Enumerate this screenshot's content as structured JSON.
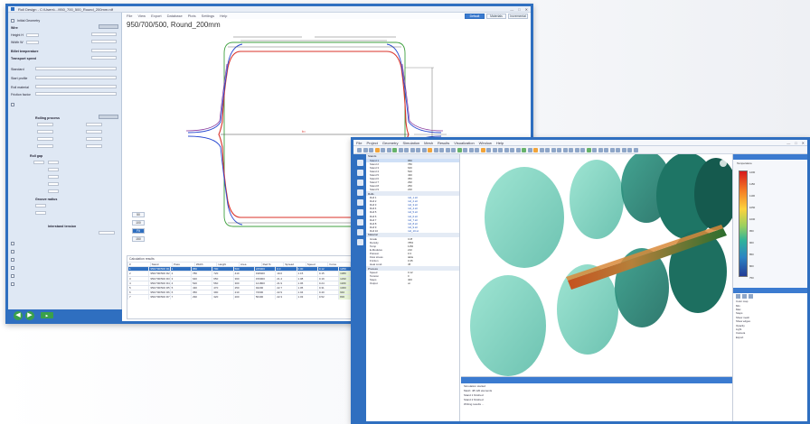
{
  "window1": {
    "title": "Roll Design - C:\\Users\\...\\950_700_500_Round_200mm.rdf",
    "menu": [
      "File",
      "View",
      "Export",
      "Database",
      "Plots",
      "Settings",
      "Help"
    ],
    "tabs": [
      "Default",
      "Materials",
      "Incremental"
    ],
    "drawing_title": "950/700/500, Round_200mm",
    "sidebar": [
      "Initial Geometry",
      "Wire",
      "Height H",
      "Width W",
      "Billet temperature",
      "Transport speed",
      "Standard",
      "Start profile",
      "Roll material",
      "Friction factor",
      "Rolling process",
      "Roll gap",
      "Groove radius",
      "Interstand tension",
      "Stand layout",
      "Pass schedule"
    ],
    "zoom_buttons": [
      "50",
      "100",
      "Fit",
      "150"
    ],
    "table_caption": "Calculation results",
    "table_headers": [
      "#",
      "Stand",
      "Pass",
      "Width",
      "Height",
      "Area",
      "Red %",
      "Spread",
      "Speed",
      "Force",
      "Torque",
      "Power",
      "Temp",
      "Gap",
      "Radius",
      "Strain",
      "Rate",
      "Dia"
    ],
    "table_rows": [
      [
        "950/700/500 R1",
        "1",
        "950",
        "700",
        "500",
        "245000",
        "0.0",
        "0.00",
        "0.12",
        "1250",
        "145",
        "210",
        "1150",
        "25",
        "200",
        "0.21",
        "0.45",
        "950"
      ],
      [
        "950/700/500 R2",
        "2",
        "780",
        "720",
        "410",
        "198400",
        "19.0",
        "1.15",
        "0.15",
        "1380",
        "162",
        "245",
        "1135",
        "22",
        "200",
        "0.24",
        "0.52",
        "950"
      ],
      [
        "950/700/500 R3",
        "3",
        "640",
        "650",
        "360",
        "156000",
        "21.4",
        "1.08",
        "0.19",
        "1290",
        "151",
        "238",
        "1120",
        "20",
        "180",
        "0.26",
        "0.61",
        "900"
      ],
      [
        "950/700/500 R4",
        "4",
        "520",
        "560",
        "300",
        "121800",
        "21.9",
        "1.06",
        "0.24",
        "1180",
        "138",
        "226",
        "1105",
        "18",
        "160",
        "0.27",
        "0.73",
        "850"
      ],
      [
        "950/700/500 R5",
        "5",
        "430",
        "470",
        "250",
        "94200",
        "22.7",
        "1.05",
        "0.31",
        "1060",
        "121",
        "212",
        "1090",
        "16",
        "150",
        "0.29",
        "0.88",
        "800"
      ],
      [
        "950/700/500 R6",
        "6",
        "350",
        "390",
        "210",
        "72600",
        "22.9",
        "1.04",
        "0.40",
        "940",
        "104",
        "198",
        "1075",
        "14",
        "140",
        "0.30",
        "1.05",
        "750"
      ],
      [
        "950/700/500 R7",
        "7",
        "290",
        "320",
        "200",
        "56400",
        "22.3",
        "1.03",
        "0.52",
        "830",
        "90",
        "184",
        "1060",
        "12",
        "130",
        "0.31",
        "1.26",
        "700"
      ]
    ]
  },
  "window2": {
    "title": "Rolling Simulation - 3D View",
    "menu": [
      "File",
      "Project",
      "Geometry",
      "Simulation",
      "Mesh",
      "Results",
      "Visualization",
      "Window",
      "Help"
    ],
    "tree_sections": [
      {
        "name": "Stands",
        "items": [
          [
            "Stand 1",
            "950"
          ],
          [
            "Stand 2",
            "780"
          ],
          [
            "Stand 3",
            "640"
          ],
          [
            "Stand 4",
            "520"
          ],
          [
            "Stand 5",
            "430"
          ],
          [
            "Stand 6",
            "350"
          ],
          [
            "Stand 7",
            "290"
          ],
          [
            "Stand 8",
            "250"
          ],
          [
            "Stand 9",
            "220"
          ]
        ]
      },
      {
        "name": "Rolls",
        "items": [
          [
            "Roll 1",
            "roll_1.stl"
          ],
          [
            "Roll 2",
            "roll_2.stl"
          ],
          [
            "Roll 3",
            "roll_3.stl"
          ],
          [
            "Roll 4",
            "roll_4.stl"
          ],
          [
            "Roll 5",
            "roll_5.stl"
          ],
          [
            "Roll 6",
            "roll_6.stl"
          ],
          [
            "Roll 7",
            "roll_7.stl"
          ],
          [
            "Roll 8",
            "roll_8.stl"
          ],
          [
            "Roll 9",
            "roll_9.stl"
          ],
          [
            "Roll 10",
            "roll_10.stl"
          ]
        ]
      },
      {
        "name": "Material",
        "items": [
          [
            "Grade",
            "C45"
          ],
          [
            "Density",
            "7850"
          ],
          [
            "Temp",
            "1150"
          ],
          [
            "E-Modulus",
            "210"
          ],
          [
            "Poisson",
            "0.3"
          ],
          [
            "Flow stress",
            "table"
          ],
          [
            "Friction",
            "0.35"
          ],
          [
            "Heat cond.",
            "45"
          ]
        ]
      },
      {
        "name": "Process",
        "items": [
          [
            "Speed",
            "0.12"
          ],
          [
            "Tension",
            "0"
          ],
          [
            "Steps",
            "400"
          ],
          [
            "Output",
            "on"
          ]
        ]
      }
    ],
    "console_lines": [
      "Simulation started",
      "Mesh: 48 120 elements",
      "Stand 1 finished",
      "Stand 2 finished",
      "Writing results ..."
    ],
    "legend_title": "Temperature",
    "legend_values": [
      "1200",
      "1150",
      "1100",
      "1050",
      "1000",
      "950",
      "900",
      "850",
      "800",
      "750"
    ],
    "props": [
      "Color map",
      "Min",
      "Max",
      "Steps",
      "Show mesh",
      "Show edges",
      "Opacity",
      "Light",
      "Camera",
      "Export"
    ]
  }
}
